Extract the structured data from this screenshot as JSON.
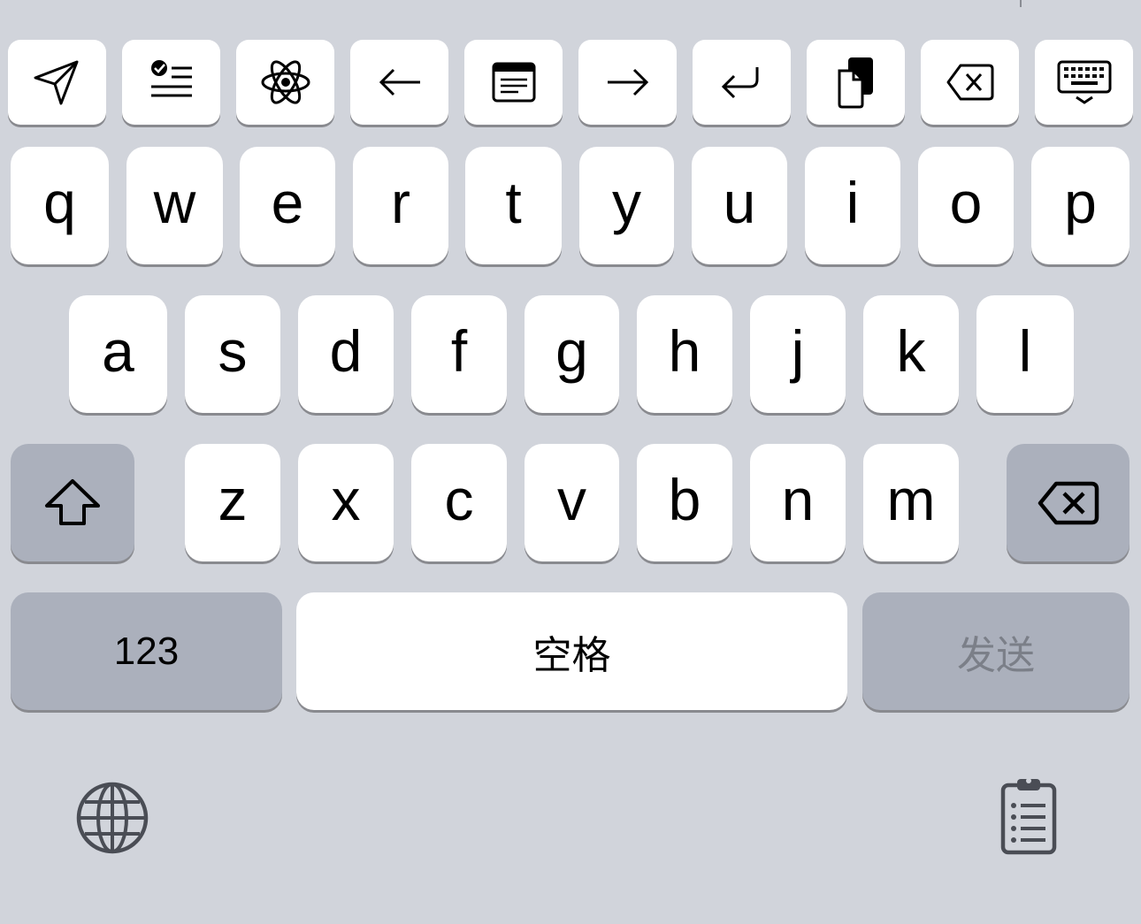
{
  "toolbar": {
    "icons": [
      "send-arrow-icon",
      "checklist-icon",
      "atom-icon",
      "arrow-left-icon",
      "window-icon",
      "arrow-right-icon",
      "return-icon",
      "copy-pages-icon",
      "delete-icon",
      "keyboard-hide-icon"
    ]
  },
  "keyboard": {
    "row1": [
      "q",
      "w",
      "e",
      "r",
      "t",
      "y",
      "u",
      "i",
      "o",
      "p"
    ],
    "row2": [
      "a",
      "s",
      "d",
      "f",
      "g",
      "h",
      "j",
      "k",
      "l"
    ],
    "row3": [
      "z",
      "x",
      "c",
      "v",
      "b",
      "n",
      "m"
    ],
    "numbers_label": "123",
    "space_label": "空格",
    "send_label": "发送"
  },
  "bottom_bar": {
    "left_icon": "globe-icon",
    "right_icon": "clipboard-list-icon"
  },
  "colors": {
    "background": "#d1d4db",
    "key": "#ffffff",
    "special_key": "#abb0bc",
    "send_text_disabled": "#7b7f88"
  }
}
